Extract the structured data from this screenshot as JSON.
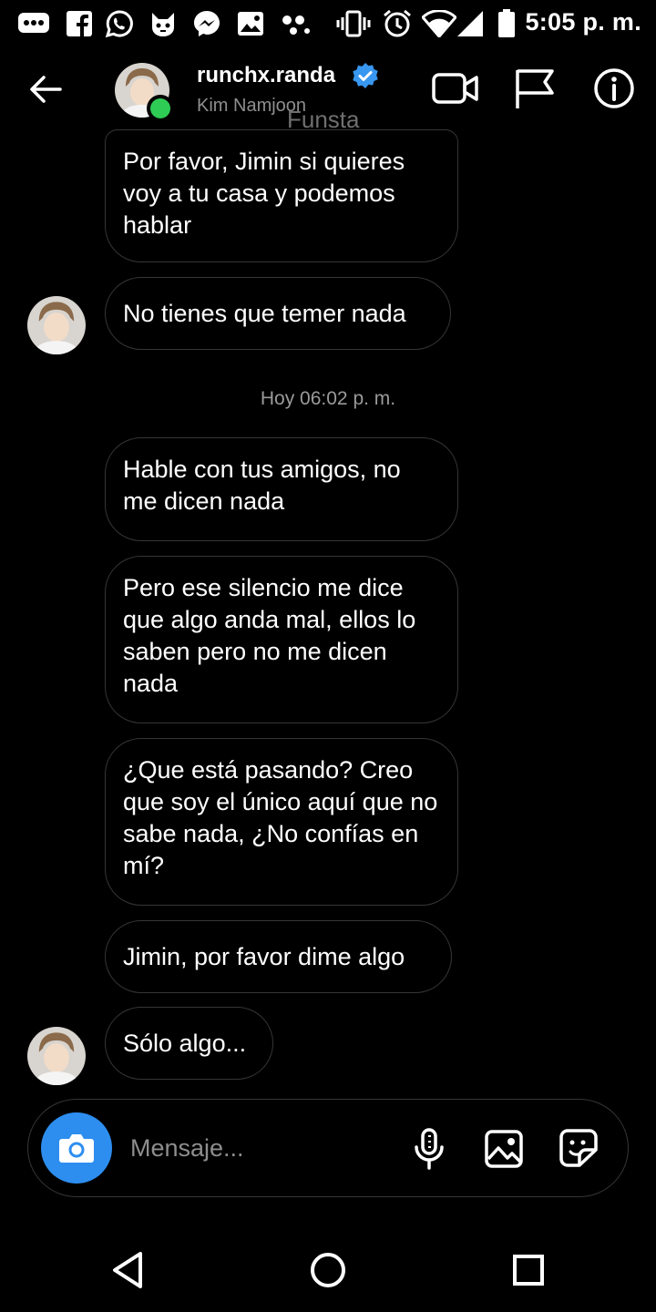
{
  "status_bar": {
    "time": "5:05 p. m.",
    "icons": [
      "message-icon",
      "facebook-icon",
      "whatsapp-icon",
      "cat-app-icon",
      "messenger-icon",
      "gallery-icon",
      "dots-icon",
      "vibrate-icon",
      "alarm-icon",
      "wifi-icon",
      "signal-icon",
      "battery-icon"
    ]
  },
  "header": {
    "username": "runchx.randa",
    "name": "Kim Namjoon",
    "overlay_text": "Funsta",
    "verified": true,
    "online": true,
    "actions": [
      "video-call-icon",
      "flag-icon",
      "info-icon"
    ]
  },
  "messages": [
    {
      "id": "m1",
      "text": "Por favor, Jimin si quieres voy a tu casa y podemos hablar"
    },
    {
      "id": "m2",
      "text": "No tienes que temer nada",
      "avatar": true
    },
    {
      "id": "m3",
      "text": "Hable con tus amigos, no me dicen nada"
    },
    {
      "id": "m4",
      "text": "Pero ese silencio me dice que algo anda mal, ellos lo saben pero no me dicen nada"
    },
    {
      "id": "m5",
      "text": "¿Que está pasando? Creo que soy el único aquí que no sabe nada, ¿No confías en mí?"
    },
    {
      "id": "m6",
      "text": "Jimin, por favor dime algo"
    },
    {
      "id": "m7",
      "text": "Sólo algo...",
      "avatar": true
    }
  ],
  "timestamp": "Hoy 06:02 p. m.",
  "composer": {
    "placeholder": "Mensaje...",
    "value": "",
    "camera_color": "#2d8ef0",
    "actions": [
      "microphone-icon",
      "image-icon",
      "sticker-icon"
    ]
  },
  "colors": {
    "background": "#000000",
    "bubble_border": "#363636",
    "verified": "#3897f0",
    "online": "#2ecc55"
  },
  "navbar": [
    "back-nav-icon",
    "home-nav-icon",
    "recents-nav-icon"
  ]
}
